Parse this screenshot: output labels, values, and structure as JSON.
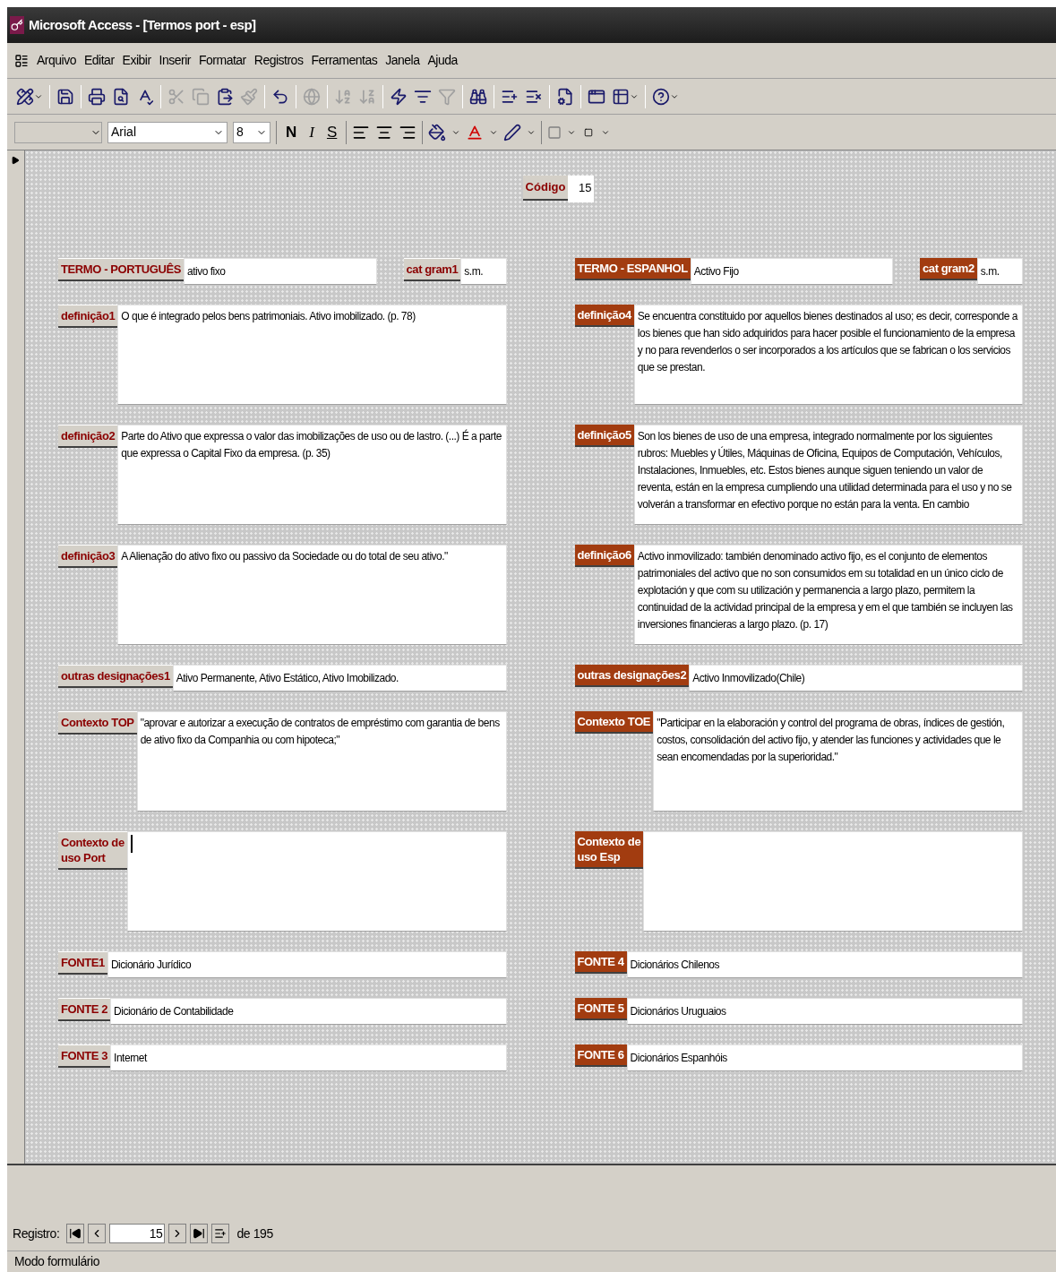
{
  "window": {
    "title": "Microsoft Access - [Termos port - esp]"
  },
  "menu": [
    {
      "label": "Arquivo"
    },
    {
      "label": "Editar"
    },
    {
      "label": "Exibir"
    },
    {
      "label": "Inserir"
    },
    {
      "label": "Formatar"
    },
    {
      "label": "Registros"
    },
    {
      "label": "Ferramentas"
    },
    {
      "label": "Janela"
    },
    {
      "label": "Ajuda"
    }
  ],
  "toolbar": [
    {
      "disabled": false
    },
    {
      "disabled": false
    },
    {
      "disabled": false
    },
    {
      "disabled": false
    },
    {
      "disabled": false
    },
    {
      "disabled": true
    },
    {
      "disabled": true
    },
    {
      "disabled": false
    },
    {
      "disabled": true
    },
    {
      "disabled": false
    },
    {
      "disabled": true
    },
    {
      "disabled": true
    },
    {
      "disabled": true
    },
    {
      "disabled": false
    },
    {
      "disabled": false
    },
    {
      "disabled": true
    },
    {
      "disabled": false
    },
    {
      "disabled": false
    },
    {
      "disabled": false
    },
    {
      "disabled": false
    },
    {
      "disabled": false
    },
    {
      "disabled": false
    },
    {
      "disabled": false
    }
  ],
  "format_toolbar": {
    "font": "Arial",
    "size": "8",
    "bold": "N",
    "italic": "I",
    "underline": "S"
  },
  "form": {
    "code": {
      "label": "Código",
      "value": "15"
    },
    "rows": [
      {
        "kind": "term",
        "left": [
          {
            "label": "TERMO - PORTUGUÊS",
            "value": "ativo fixo"
          },
          {
            "label": "cat gram1",
            "value": "s.m."
          }
        ],
        "right": [
          {
            "label": "TERMO - ESPANHOL",
            "value": "Activo Fijo"
          },
          {
            "label": "cat gram2",
            "value": "s.m."
          }
        ]
      },
      {
        "kind": "memo",
        "left": {
          "label": "definição1",
          "value": "O que é integrado pelos bens patrimoniais. Ativo imobilizado. (p. 78)"
        },
        "right": {
          "label": "definição4",
          "value": "Se encuentra constituido por aquellos bienes destinados al uso; es decir, corresponde a los bienes que han sido adquiridos para hacer posible el funcionamiento de la empresa y no para revenderlos o ser incorporados a los artículos que se fabrican o los servicios que se prestan."
        }
      },
      {
        "kind": "memo",
        "left": {
          "label": "definição2",
          "value": "Parte do Ativo que expressa o valor das imobilizações de uso ou de lastro. (...) É a parte que expressa o Capital Fixo da empresa. (p. 35)"
        },
        "right": {
          "label": "definição5",
          "value": "Son los bienes de uso de una empresa, integrado normalmente por los siguientes rubros: Muebles y Útiles, Máquinas de Oficina, Equipos de Computación, Vehículos, Instalaciones, Inmuebles, etc. Estos bienes aunque siguen teniendo un valor de reventa, están en la empresa cumpliendo una utilidad determinada para el uso y no se volverán a transformar en efectivo porque no están para la venta. En cambio"
        }
      },
      {
        "kind": "memo",
        "left": {
          "label": "definição3",
          "value": "A Alienação do ativo fixo ou passivo da Sociedade ou do total de seu ativo.\""
        },
        "right": {
          "label": "definição6",
          "value": "Activo inmovilizado: también denominado activo fijo, es el conjunto de elementos patrimoniales del activo que no son consumidos em su totalidad en un único ciclo de explotación y que com su utilización  y permanencia a largo plazo, permitem la continuidad de la actividad principal de la empresa y em el que también se incluyen las inversiones financieras a largo plazo. (p. 17)"
        }
      },
      {
        "kind": "line",
        "left": {
          "label": "outras designações1",
          "value": "Ativo Permanente, Ativo Estático, Ativo Imobilizado."
        },
        "right": {
          "label": "outras designações2",
          "value": "Activo Inmovilizado(Chile)"
        }
      },
      {
        "kind": "memo",
        "left": {
          "label": "Contexto TOP",
          "value": "\"aprovar e autorizar a execução de contratos de empréstimo com garantia de bens de ativo fixo da Companhia ou com hipoteca;\""
        },
        "right": {
          "label": "Contexto TOE",
          "value": "\"Participar en la elaboración y control del programa de obras, índices de gestión, costos, consolidación del activo fijo, y atender las funciones y actividades que le sean encomendadas por la superioridad.\""
        }
      },
      {
        "kind": "memo",
        "left": {
          "label": "Contexto de\nuso Port",
          "focused": true
        },
        "right": {
          "label": "Contexto de\nuso Esp",
          "focused": false
        }
      },
      {
        "kind": "line",
        "left": {
          "label": "FONTE1",
          "value": "Dicionário Jurídico"
        },
        "right": {
          "label": "FONTE 4",
          "value": "Dicionários Chilenos"
        }
      },
      {
        "kind": "line",
        "left": {
          "label": "FONTE 2",
          "value": "Dicionário de Contabilidade"
        },
        "right": {
          "label": "FONTE 5",
          "value": "Dicionários Uruguaios"
        }
      },
      {
        "kind": "line",
        "left": {
          "label": "FONTE 3",
          "value": "Internet"
        },
        "right": {
          "label": "FONTE 6",
          "value": "Dicionários Espanhóis"
        }
      }
    ]
  },
  "navigation": {
    "label": "Registro:",
    "value": "15",
    "total": "de 195"
  },
  "status_bar": "Modo formulário"
}
